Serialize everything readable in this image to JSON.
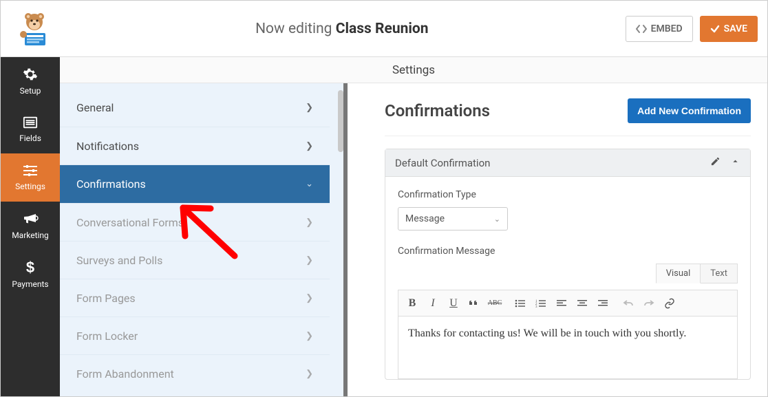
{
  "header": {
    "prefix": "Now editing",
    "form_name": "Class Reunion",
    "embed_label": "EMBED",
    "save_label": "SAVE"
  },
  "nav": {
    "items": [
      {
        "label": "Setup",
        "icon": "gear"
      },
      {
        "label": "Fields",
        "icon": "list"
      },
      {
        "label": "Settings",
        "icon": "sliders",
        "active": true
      },
      {
        "label": "Marketing",
        "icon": "bullhorn"
      },
      {
        "label": "Payments",
        "icon": "dollar"
      }
    ]
  },
  "settings_band_title": "Settings",
  "side_settings": {
    "items": [
      {
        "label": "General"
      },
      {
        "label": "Notifications"
      },
      {
        "label": "Confirmations",
        "active": true
      },
      {
        "label": "Conversational Forms"
      },
      {
        "label": "Surveys and Polls"
      },
      {
        "label": "Form Pages"
      },
      {
        "label": "Form Locker"
      },
      {
        "label": "Form Abandonment"
      }
    ]
  },
  "right": {
    "title": "Confirmations",
    "add_button": "Add New Confirmation",
    "accordion_title": "Default Confirmation",
    "type_label": "Confirmation Type",
    "type_value": "Message",
    "message_label": "Confirmation Message",
    "editor_tabs": {
      "visual": "Visual",
      "text": "Text"
    },
    "editor_content": "Thanks for contacting us! We will be in touch with you shortly."
  }
}
